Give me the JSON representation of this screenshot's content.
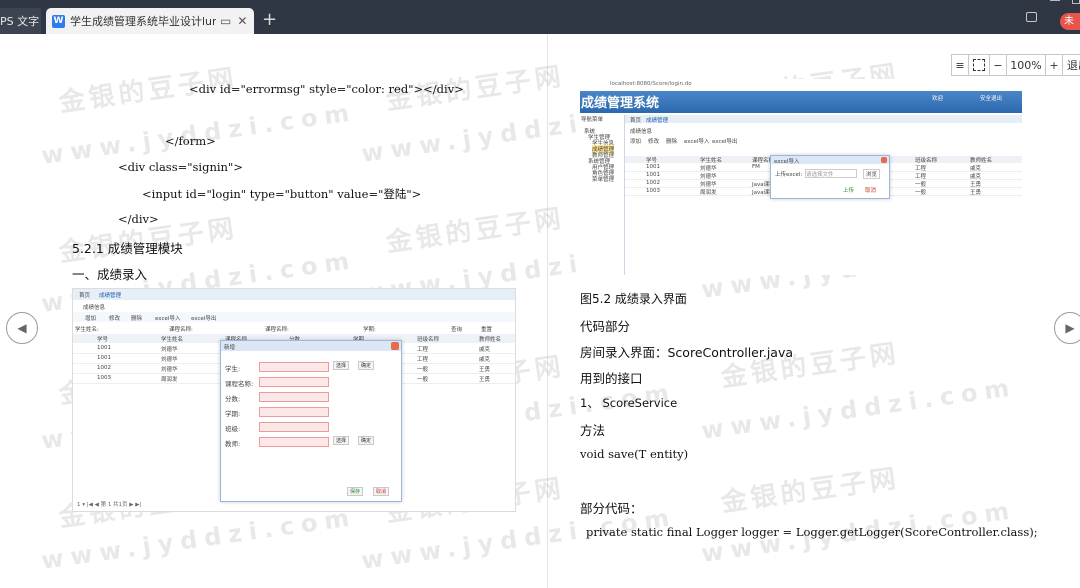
{
  "browser": {
    "tabs": [
      {
        "label": "PS 文字"
      },
      {
        "label": "学生成绩管理系统毕业设计lun文",
        "icon": "wps-doc-icon"
      }
    ],
    "new_tab": "+",
    "unregistered": "未"
  },
  "zoom": {
    "minus": "−",
    "value": "100%",
    "plus": "+",
    "exit": "退出"
  },
  "nav": {
    "prev": "◀",
    "next": "▶"
  },
  "left_page": {
    "code_lines": [
      "<div id=\"errormsg\" style=\"color: red\"></div>",
      "</form>",
      "<div class=\"signin\">",
      "<input id=\"login\" type=\"button\" value=\"登陆\">",
      "</div>"
    ],
    "section": "5.2.1   成绩管理模块",
    "subsection": "一、成绩录入",
    "screenshot": {
      "tabs": [
        "首页",
        "成绩管理"
      ],
      "panel": "成绩信息",
      "toolbar": [
        "增加",
        "修改",
        "删除",
        "excel导入",
        "excel导出"
      ],
      "filters": [
        "学生姓名:",
        "课程名称:",
        "课程名称:",
        "学期:"
      ],
      "search": "查询",
      "reset": "重置",
      "columns": [
        "学号",
        "学生姓名",
        "课程名称",
        "分数",
        "学期",
        "班级名称",
        "教师姓名"
      ],
      "rows": [
        [
          "1001",
          "刘德华",
          "",
          "",
          "",
          "工程",
          "戚克"
        ],
        [
          "1001",
          "刘德华",
          "",
          "",
          "",
          "工程",
          "戚克"
        ],
        [
          "1002",
          "刘德华",
          "",
          "",
          "",
          "一般",
          "王勇"
        ],
        [
          "1003",
          "周润发",
          "",
          "",
          "",
          "一般",
          "王勇"
        ]
      ],
      "dialog": {
        "title": "新增",
        "fields": [
          "学生:",
          "课程名称:",
          "分数:",
          "学期:",
          "班级:",
          "教师:"
        ],
        "select": "选择",
        "confirm": "确定",
        "save": "保存",
        "cancel": "取消"
      },
      "pager": "1 ▾  |◀ ◀  第 1  共1页  ▶ ▶|"
    }
  },
  "right_page": {
    "screenshot": {
      "url": "localhost:8080/Score/login.do",
      "app_title": "成绩管理系统",
      "header_links": [
        "安全退出",
        "欢迎"
      ],
      "menu_title": "导航菜单",
      "tree": [
        "系统",
        "学生管理",
        "学生信息",
        "成绩管理",
        "教师管理",
        "系统管理",
        "用户管理",
        "角色管理",
        "菜单管理"
      ],
      "tabs": [
        "首页",
        "成绩管理"
      ],
      "panel": "成绩信息",
      "toolbar": [
        "添加",
        "修改",
        "删除",
        "excel导入",
        "excel导出"
      ],
      "dialog": {
        "title": "excel导入",
        "label": "上传excel:",
        "placeholder": "请选择文件",
        "browse": "浏览",
        "upload": "上传",
        "cancel": "取消"
      },
      "columns": [
        "学号",
        "学生姓名",
        "课程名称",
        "分数",
        "学期",
        "班级名称",
        "教师姓名"
      ],
      "rows": [
        [
          "1001",
          "刘德华",
          "FM",
          "",
          "",
          "工程",
          "戚克"
        ],
        [
          "1001",
          "刘德华",
          "",
          "",
          "",
          "工程",
          "戚克"
        ],
        [
          "1002",
          "刘德华",
          "Java课程",
          "",
          "",
          "一般",
          "王勇"
        ],
        [
          "1003",
          "周润发",
          "Java课程",
          "",
          "",
          "一般",
          "王勇"
        ]
      ]
    },
    "caption": "图5.2 成绩录入界面",
    "lines": [
      "代码部分",
      "房间录入界面：ScoreController.java",
      "用到的接口",
      "1、 ScoreService",
      "方法",
      "void save(T entity)",
      "部分代码：",
      "private static final Logger logger = Logger.getLogger(ScoreController.class);"
    ]
  },
  "watermark": {
    "cn": "金银的豆子网",
    "en": "www.jyddzi.com"
  }
}
